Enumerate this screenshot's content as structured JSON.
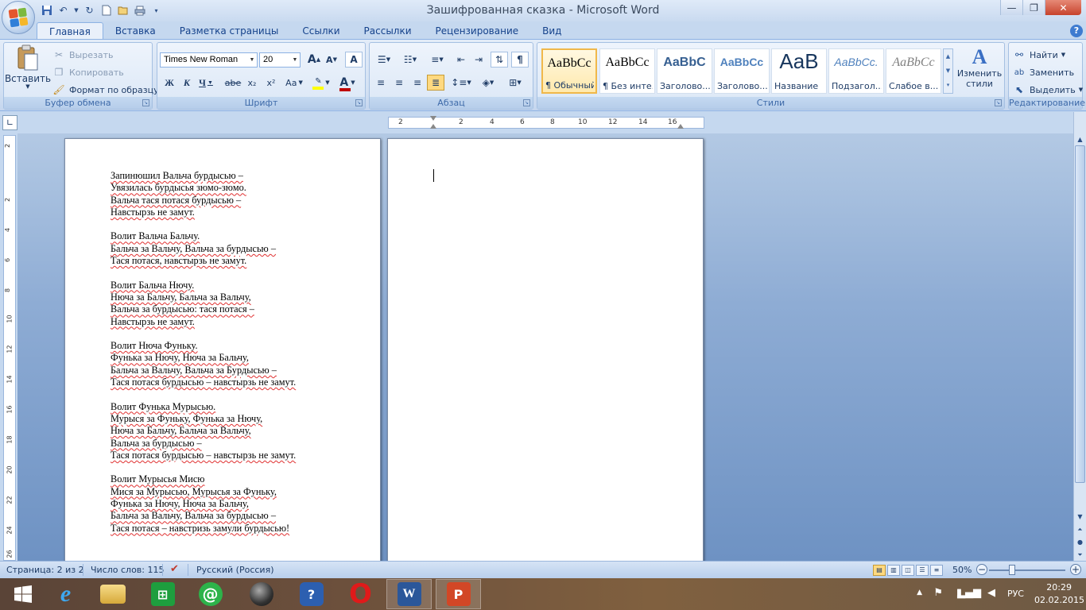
{
  "window": {
    "title": "Зашифрованная сказка - Microsoft Word",
    "minimize_glyph": "—",
    "maximize_glyph": "❐",
    "close_glyph": "✕"
  },
  "qat": [
    "save-icon",
    "undo-icon",
    "redo-icon",
    "new-icon",
    "open-icon",
    "print-icon",
    "customize-icon"
  ],
  "tabs": [
    "Главная",
    "Вставка",
    "Разметка страницы",
    "Ссылки",
    "Рассылки",
    "Рецензирование",
    "Вид"
  ],
  "ribbon": {
    "clipboard": {
      "label": "Буфер обмена",
      "paste": "Вставить",
      "cut": "Вырезать",
      "copy": "Копировать",
      "format_painter": "Формат по образцу"
    },
    "font": {
      "label": "Шрифт",
      "font_name": "Times New Roman",
      "font_size": "20",
      "bold": "Ж",
      "italic": "К",
      "underline": "Ч",
      "strike": "abe",
      "subscript": "x₂",
      "superscript": "x²",
      "case": "Aa",
      "grow": "A",
      "shrink": "A",
      "clear": "A",
      "font_color": "A",
      "highlight_color": "#ffff00",
      "font_color_value": "#c00000"
    },
    "paragraph": {
      "label": "Абзац",
      "pilcrow": "¶"
    },
    "styles": {
      "label": "Стили",
      "items": [
        {
          "sample": "AaBbCc",
          "name": "¶ Обычный"
        },
        {
          "sample": "AaBbCc",
          "name": "¶ Без инте..."
        },
        {
          "sample": "AaBbC",
          "name": "Заголово..."
        },
        {
          "sample": "AaBbCc",
          "name": "Заголово..."
        },
        {
          "sample": "AaB",
          "name": "Название"
        },
        {
          "sample": "AaBbCc.",
          "name": "Подзагол..."
        },
        {
          "sample": "AaBbCc",
          "name": "Слабое в..."
        }
      ],
      "change_styles_1": "Изменить",
      "change_styles_2": "стили"
    },
    "editing": {
      "label": "Редактирование",
      "find": "Найти",
      "replace": "Заменить",
      "select": "Выделить"
    }
  },
  "ruler": {
    "horizontal_ticks": [
      "2",
      "2",
      "4",
      "6",
      "8",
      "10",
      "12",
      "14",
      "16"
    ],
    "vertical_ticks": [
      "2",
      "2",
      "4",
      "6",
      "8",
      "10",
      "12",
      "14",
      "16",
      "18",
      "20",
      "22",
      "24",
      "26"
    ]
  },
  "document": {
    "stanzas": [
      [
        "Запинюшил Вальча бурдысью –",
        "Увязилась бурдысья зюмо-зюмо.",
        "Вальча тася потася бурдысью –",
        "Навстырзь не замут."
      ],
      [
        "Волит Вальча Бальчу.",
        "Бальча за Вальчу, Вальча за бурдысью –",
        "Тася потася, навстырзь не замут."
      ],
      [
        "Волит Бальча Нючу.",
        "Нюча за Бальчу, Бальча за Вальчу,",
        "Вальча за бурдысью: тася потася –",
        "Навстырзь не замут."
      ],
      [
        "Волит Нюча Фуньку.",
        "Фунька за Нючу, Нюча за Бальчу,",
        "Бальча за Вальчу, Вальча за Бурдысью –",
        "Тася потася бурдысью – навстырзь не замут."
      ],
      [
        "Волит Фунька Мурысью.",
        "Мурыся за Фуньку, Фунька за Нючу,",
        "Нюча за Бальчу, Бальча за Вальчу,",
        "Вальча за бурдысью –",
        "Тася потася бурдысью – навстырзь не замут."
      ],
      [
        "Волит Мурысья Мисю",
        "Мися за Мурысью, Мурысья за Фуньку,",
        "Фунька за Нючу, Нюча за Бальчу,",
        "Бальча за Вальчу, Вальча за бурдысью –",
        "Тася потася – навстризь замули бурдысью!"
      ]
    ]
  },
  "status": {
    "page": "Страница: 2 из 2",
    "words": "Число слов: 115",
    "language": "Русский (Россия)",
    "zoom": "50%",
    "zoom_fraction": 0.3
  },
  "taskbar": {
    "apps": [
      "start-icon",
      "ie-icon",
      "explorer-icon",
      "excel-icon",
      "at-icon",
      "media-icon",
      "help-icon",
      "opera-icon",
      "word-icon",
      "powerpoint-icon"
    ],
    "language": "РУС",
    "time": "20:29",
    "date": "02.02.2015"
  }
}
